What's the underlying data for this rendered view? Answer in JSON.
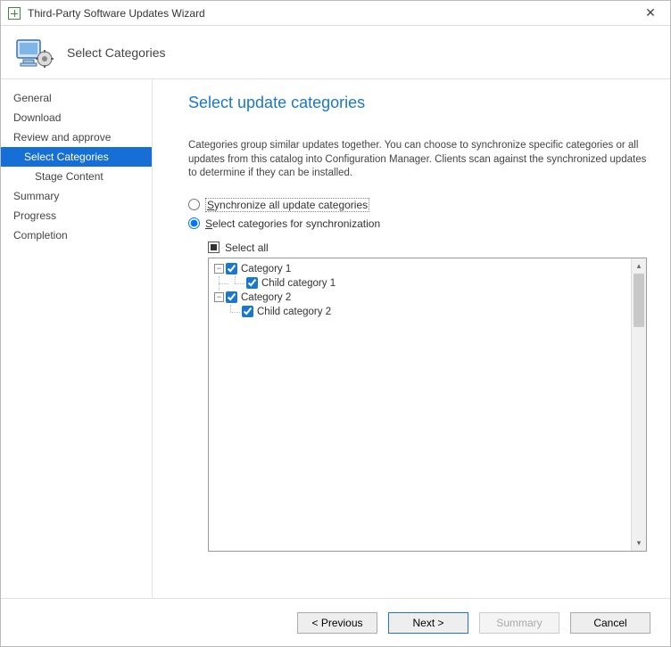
{
  "window": {
    "title": "Third-Party Software Updates Wizard"
  },
  "header": {
    "title": "Select Categories"
  },
  "sidebar": {
    "items": [
      {
        "label": "General",
        "indent": 1,
        "selected": false
      },
      {
        "label": "Download",
        "indent": 1,
        "selected": false
      },
      {
        "label": "Review and approve",
        "indent": 1,
        "selected": false
      },
      {
        "label": "Select Categories",
        "indent": 2,
        "selected": true
      },
      {
        "label": "Stage Content",
        "indent": 3,
        "selected": false
      },
      {
        "label": "Summary",
        "indent": 1,
        "selected": false
      },
      {
        "label": "Progress",
        "indent": 1,
        "selected": false
      },
      {
        "label": "Completion",
        "indent": 1,
        "selected": false
      }
    ]
  },
  "content": {
    "title": "Select update categories",
    "description": "Categories group similar updates together. You can choose to synchronize specific categories or all updates from this catalog into Configuration Manager. Clients scan against the synchronized updates to determine if they can be installed.",
    "radios": {
      "sync_all": "Synchronize all update categories",
      "select": "Select categories for synchronization"
    },
    "select_all_label": "Select all",
    "tree": [
      {
        "label": "Category 1",
        "checked": true
      },
      {
        "label": "Child category 1",
        "checked": true
      },
      {
        "label": "Category 2",
        "checked": true
      },
      {
        "label": "Child category 2",
        "checked": true
      }
    ]
  },
  "footer": {
    "previous": "< Previous",
    "next": "Next >",
    "summary": "Summary",
    "cancel": "Cancel"
  }
}
